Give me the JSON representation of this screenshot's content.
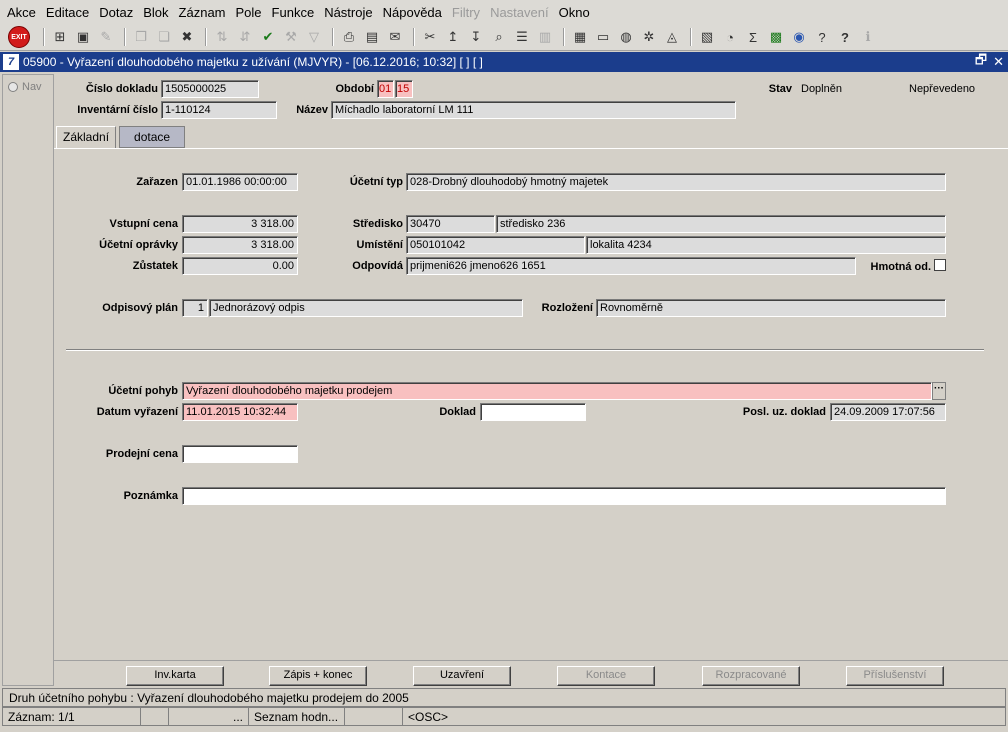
{
  "menu": [
    "Akce",
    "Editace",
    "Dotaz",
    "Blok",
    "Záznam",
    "Pole",
    "Funkce",
    "Nástroje",
    "Nápověda",
    "Filtry",
    "Nastavení",
    "Okno"
  ],
  "menu_disabled": [
    "Filtry",
    "Nastavení"
  ],
  "toolbar": {
    "exit_label": "EXIT",
    "icons": [
      "insert-record-icon",
      "save-icon",
      "clear-icon",
      "copy-icon",
      "paste-icon",
      "delete-icon",
      "sort-asc-icon",
      "sort-desc-icon",
      "check-icon",
      "tool-icon",
      "filter-icon",
      "print-icon",
      "print-preview-icon",
      "mail-icon",
      "cut-icon",
      "export-icon",
      "import-icon",
      "search-icon",
      "list-icon",
      "columns-icon",
      "document-icon",
      "attachment-icon",
      "globe-icon",
      "settings-icon",
      "eye-icon",
      "chart-icon",
      "calc-icon",
      "sigma-icon",
      "excel-icon",
      "word-icon",
      "wizard-icon",
      "help-icon",
      "info-icon"
    ]
  },
  "window": {
    "title": "05900 - Vyřazení dlouhodobého majetku z užívání (MJVYR) - [06.12.2016; 10:32]  [ ]  [ ]",
    "restore_glyph": "🗗",
    "close_glyph": "✕",
    "app_icon_text": "7"
  },
  "nav": {
    "label": "Nav"
  },
  "header": {
    "cislo_dokladu_label": "Číslo dokladu",
    "cislo_dokladu": "1505000025",
    "obdobi_label": "Období",
    "obdobi_1": "01",
    "obdobi_2": "15",
    "stav_label": "Stav",
    "stav_value": "Doplněn",
    "neprevedeno": "Nepřevedeno",
    "inventarni_cislo_label": "Inventární číslo",
    "inventarni_cislo": "1-110124",
    "nazev_label": "Název",
    "nazev": "Míchadlo laboratorní LM 111"
  },
  "tabs": [
    "Základní",
    "dotace"
  ],
  "form": {
    "zarazen_label": "Zařazen",
    "zarazen": "01.01.1986 00:00:00",
    "ucetni_typ_label": "Účetní typ",
    "ucetni_typ": "028-Drobný dlouhodobý hmotný majetek",
    "vstupni_cena_label": "Vstupní cena",
    "vstupni_cena": "3 318.00",
    "stredisko_label": "Středisko",
    "stredisko_code": "30470",
    "stredisko_name": "středisko 236",
    "ucetni_opravky_label": "Účetní oprávky",
    "ucetni_opravky": "3 318.00",
    "umisteni_label": "Umístění",
    "umisteni_code": "050101042",
    "umisteni_name": "lokalita 4234",
    "zustatek_label": "Zůstatek",
    "zustatek": "0.00",
    "odpovida_label": "Odpovídá",
    "odpovida": "prijmeni626 jmeno626 1651",
    "hmotna_od_label": "Hmotná od.",
    "odpisovy_plan_label": "Odpisový plán",
    "odpisovy_plan_code": "1",
    "odpisovy_plan_name": "Jednorázový odpis",
    "rozlozeni_label": "Rozložení",
    "rozlozeni": "Rovnoměrně",
    "ucetni_pohyb_label": "Účetní pohyb",
    "ucetni_pohyb": "Vyřazení dlouhodobého majetku prodejem",
    "lov_button": "···",
    "datum_vyrazeni_label": "Datum vyřazení",
    "datum_vyrazeni": "11.01.2015 10:32:44",
    "doklad_label": "Doklad",
    "doklad": "",
    "posl_uz_doklad_label": "Posl. uz. doklad",
    "posl_uz_doklad": "24.09.2009 17:07:56",
    "prodejni_cena_label": "Prodejní cena",
    "prodejni_cena": "",
    "poznamka_label": "Poznámka",
    "poznamka": ""
  },
  "buttons": [
    {
      "label": "Inv.karta",
      "enabled": true
    },
    {
      "label": "Zápis + konec",
      "enabled": true
    },
    {
      "label": "Uzavření",
      "enabled": true
    },
    {
      "label": "Kontace",
      "enabled": false
    },
    {
      "label": "Rozpracované",
      "enabled": false
    },
    {
      "label": "Příslušenství",
      "enabled": false
    }
  ],
  "status": {
    "hint": "Druh účetního pohybu : Vyřazení dlouhodobého majetku prodejem do 2005",
    "record": "Záznam: 1/1",
    "c2": "",
    "c3": "...",
    "list": "Seznam hodn...",
    "c5": "",
    "osc": "<OSC>"
  }
}
